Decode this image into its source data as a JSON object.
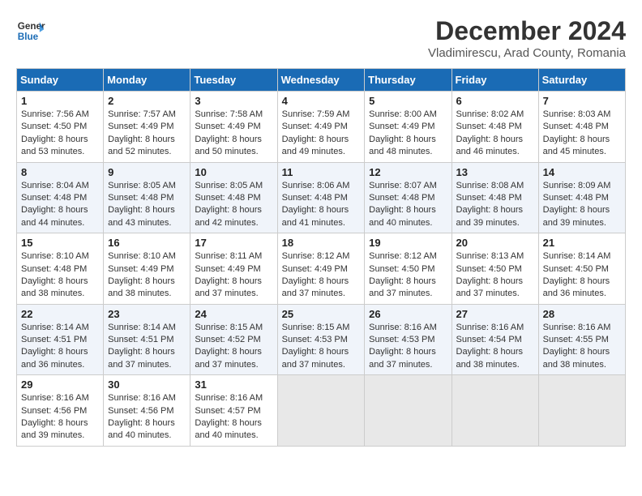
{
  "header": {
    "logo_line1": "General",
    "logo_line2": "Blue",
    "title": "December 2024",
    "subtitle": "Vladimirescu, Arad County, Romania"
  },
  "days_of_week": [
    "Sunday",
    "Monday",
    "Tuesday",
    "Wednesday",
    "Thursday",
    "Friday",
    "Saturday"
  ],
  "weeks": [
    [
      {
        "day": 1,
        "sunrise": "7:56 AM",
        "sunset": "4:50 PM",
        "daylight": "8 hours and 53 minutes."
      },
      {
        "day": 2,
        "sunrise": "7:57 AM",
        "sunset": "4:49 PM",
        "daylight": "8 hours and 52 minutes."
      },
      {
        "day": 3,
        "sunrise": "7:58 AM",
        "sunset": "4:49 PM",
        "daylight": "8 hours and 50 minutes."
      },
      {
        "day": 4,
        "sunrise": "7:59 AM",
        "sunset": "4:49 PM",
        "daylight": "8 hours and 49 minutes."
      },
      {
        "day": 5,
        "sunrise": "8:00 AM",
        "sunset": "4:49 PM",
        "daylight": "8 hours and 48 minutes."
      },
      {
        "day": 6,
        "sunrise": "8:02 AM",
        "sunset": "4:48 PM",
        "daylight": "8 hours and 46 minutes."
      },
      {
        "day": 7,
        "sunrise": "8:03 AM",
        "sunset": "4:48 PM",
        "daylight": "8 hours and 45 minutes."
      }
    ],
    [
      {
        "day": 8,
        "sunrise": "8:04 AM",
        "sunset": "4:48 PM",
        "daylight": "8 hours and 44 minutes."
      },
      {
        "day": 9,
        "sunrise": "8:05 AM",
        "sunset": "4:48 PM",
        "daylight": "8 hours and 43 minutes."
      },
      {
        "day": 10,
        "sunrise": "8:05 AM",
        "sunset": "4:48 PM",
        "daylight": "8 hours and 42 minutes."
      },
      {
        "day": 11,
        "sunrise": "8:06 AM",
        "sunset": "4:48 PM",
        "daylight": "8 hours and 41 minutes."
      },
      {
        "day": 12,
        "sunrise": "8:07 AM",
        "sunset": "4:48 PM",
        "daylight": "8 hours and 40 minutes."
      },
      {
        "day": 13,
        "sunrise": "8:08 AM",
        "sunset": "4:48 PM",
        "daylight": "8 hours and 39 minutes."
      },
      {
        "day": 14,
        "sunrise": "8:09 AM",
        "sunset": "4:48 PM",
        "daylight": "8 hours and 39 minutes."
      }
    ],
    [
      {
        "day": 15,
        "sunrise": "8:10 AM",
        "sunset": "4:48 PM",
        "daylight": "8 hours and 38 minutes."
      },
      {
        "day": 16,
        "sunrise": "8:10 AM",
        "sunset": "4:49 PM",
        "daylight": "8 hours and 38 minutes."
      },
      {
        "day": 17,
        "sunrise": "8:11 AM",
        "sunset": "4:49 PM",
        "daylight": "8 hours and 37 minutes."
      },
      {
        "day": 18,
        "sunrise": "8:12 AM",
        "sunset": "4:49 PM",
        "daylight": "8 hours and 37 minutes."
      },
      {
        "day": 19,
        "sunrise": "8:12 AM",
        "sunset": "4:50 PM",
        "daylight": "8 hours and 37 minutes."
      },
      {
        "day": 20,
        "sunrise": "8:13 AM",
        "sunset": "4:50 PM",
        "daylight": "8 hours and 37 minutes."
      },
      {
        "day": 21,
        "sunrise": "8:14 AM",
        "sunset": "4:50 PM",
        "daylight": "8 hours and 36 minutes."
      }
    ],
    [
      {
        "day": 22,
        "sunrise": "8:14 AM",
        "sunset": "4:51 PM",
        "daylight": "8 hours and 36 minutes."
      },
      {
        "day": 23,
        "sunrise": "8:14 AM",
        "sunset": "4:51 PM",
        "daylight": "8 hours and 37 minutes."
      },
      {
        "day": 24,
        "sunrise": "8:15 AM",
        "sunset": "4:52 PM",
        "daylight": "8 hours and 37 minutes."
      },
      {
        "day": 25,
        "sunrise": "8:15 AM",
        "sunset": "4:53 PM",
        "daylight": "8 hours and 37 minutes."
      },
      {
        "day": 26,
        "sunrise": "8:16 AM",
        "sunset": "4:53 PM",
        "daylight": "8 hours and 37 minutes."
      },
      {
        "day": 27,
        "sunrise": "8:16 AM",
        "sunset": "4:54 PM",
        "daylight": "8 hours and 38 minutes."
      },
      {
        "day": 28,
        "sunrise": "8:16 AM",
        "sunset": "4:55 PM",
        "daylight": "8 hours and 38 minutes."
      }
    ],
    [
      {
        "day": 29,
        "sunrise": "8:16 AM",
        "sunset": "4:56 PM",
        "daylight": "8 hours and 39 minutes."
      },
      {
        "day": 30,
        "sunrise": "8:16 AM",
        "sunset": "4:56 PM",
        "daylight": "8 hours and 40 minutes."
      },
      {
        "day": 31,
        "sunrise": "8:16 AM",
        "sunset": "4:57 PM",
        "daylight": "8 hours and 40 minutes."
      },
      null,
      null,
      null,
      null
    ]
  ],
  "labels": {
    "sunrise": "Sunrise: ",
    "sunset": "Sunset: ",
    "daylight": "Daylight: "
  }
}
